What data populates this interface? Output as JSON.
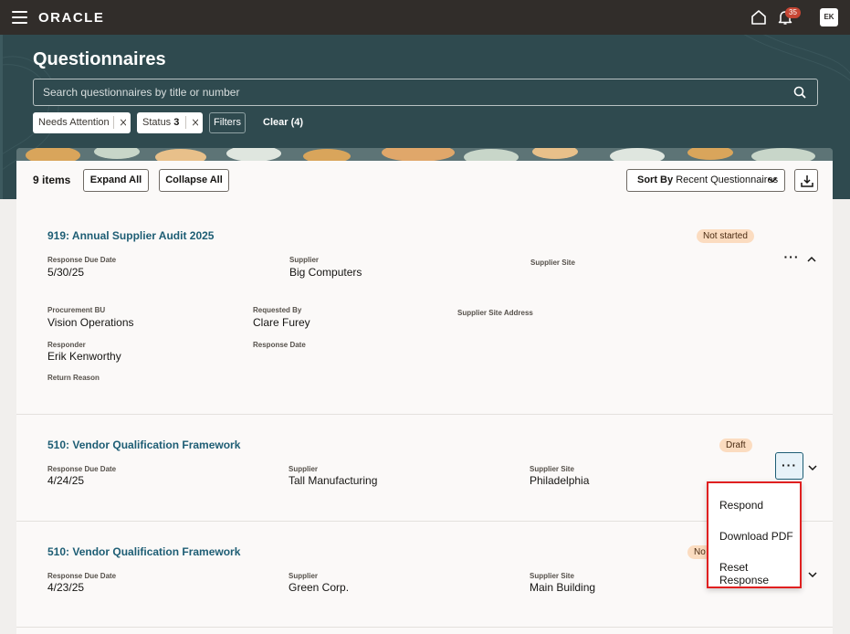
{
  "topbar": {
    "logo": "ORACLE",
    "notification_count": "35",
    "avatar_initials": "EK"
  },
  "header": {
    "title": "Questionnaires",
    "search_placeholder": "Search questionnaires by title or number",
    "chips": [
      {
        "label": "Needs Attention"
      },
      {
        "label": "Status",
        "count": "3"
      }
    ],
    "filters_label": "Filters",
    "clear_label": "Clear (4)"
  },
  "toolbar": {
    "items_count": "9 items",
    "expand_all": "Expand All",
    "collapse_all": "Collapse All",
    "sort_prefix": "Sort By",
    "sort_value": "Recent Questionnaires"
  },
  "rows": [
    {
      "title": "919: Annual Supplier Audit 2025",
      "status": "Not started",
      "response_due_date_label": "Response Due Date",
      "response_due_date": "5/30/25",
      "supplier_label": "Supplier",
      "supplier": "Big Computers",
      "supplier_site_label": "Supplier Site",
      "supplier_site": "",
      "procurement_bu_label": "Procurement BU",
      "procurement_bu": "Vision Operations",
      "requested_by_label": "Requested By",
      "requested_by": "Clare Furey",
      "supplier_site_address_label": "Supplier Site Address",
      "responder_label": "Responder",
      "responder": "Erik Kenworthy",
      "response_date_label": "Response Date",
      "return_reason_label": "Return Reason"
    },
    {
      "title": "510: Vendor Qualification Framework",
      "status": "Draft",
      "response_due_date_label": "Response Due Date",
      "response_due_date": "4/24/25",
      "supplier_label": "Supplier",
      "supplier": "Tall Manufacturing",
      "supplier_site_label": "Supplier Site",
      "supplier_site": "Philadelphia"
    },
    {
      "title": "510: Vendor Qualification Framework",
      "status": "No",
      "response_due_date_label": "Response Due Date",
      "response_due_date": "4/23/25",
      "supplier_label": "Supplier",
      "supplier": "Green Corp.",
      "supplier_site_label": "Supplier Site",
      "supplier_site": "Main Building"
    }
  ],
  "actions_menu": {
    "items": [
      "Respond",
      "Download PDF",
      "Reset Response"
    ]
  },
  "colors": {
    "topbar": "#312d2a",
    "header": "#2f4a4f",
    "link": "#1d5d74",
    "badge": "#fbdcc0",
    "highlight": "#e02020"
  }
}
